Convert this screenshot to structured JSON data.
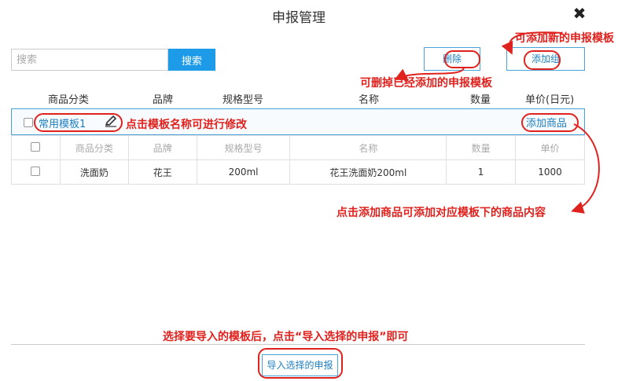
{
  "dialog": {
    "title": "申报管理",
    "close_icon": "✖"
  },
  "search": {
    "placeholder": "搜索",
    "button": "搜索"
  },
  "toolbar": {
    "delete_label": "删除",
    "add_group_label": "添加组"
  },
  "columns": [
    "商品分类",
    "品牌",
    "规格型号",
    "名称",
    "数量",
    "单价(日元)"
  ],
  "group": {
    "name": "常用模板1",
    "add_goods_label": "添加商品"
  },
  "table": {
    "headers": [
      "商品分类",
      "品牌",
      "规格型号",
      "名称",
      "数量",
      "单价"
    ],
    "rows": [
      {
        "category": "洗面奶",
        "brand": "花王",
        "spec": "200ml",
        "name": "花王洗面奶200ml",
        "qty": "1",
        "price": "1000"
      }
    ]
  },
  "annotations": {
    "add_template": "可添加新的申报模板",
    "delete_template": "可删掉已经添加的申报模板",
    "rename": "点击模板名称可进行修改",
    "add_goods": "点击添加商品可添加对应模板下的商品内容",
    "import": "选择要导入的模板后，点击“导入选择的申报”即可"
  },
  "footer": {
    "import_label": "导入选择的申报"
  },
  "colors": {
    "accent": "#1e9be8",
    "annotation": "#e0221e",
    "border": "#4aa3d6"
  }
}
